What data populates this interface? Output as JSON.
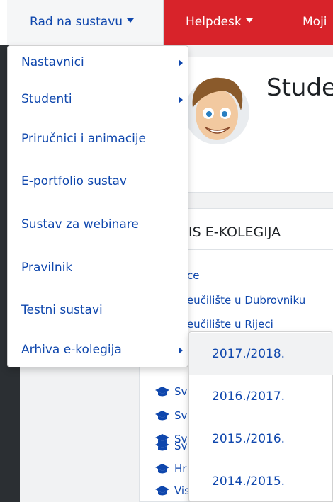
{
  "navbar": {
    "items": [
      {
        "label": "Rad na sustavu",
        "active": true
      },
      {
        "label": "Helpdesk",
        "active": false
      },
      {
        "label": "Moji",
        "active": false
      }
    ]
  },
  "profile": {
    "title": "Stude"
  },
  "courses": {
    "header": "IS E-KOLEGIJA",
    "lines": [
      "ce",
      "veučilište u Dubrovniku",
      "veučilište u Rijeci"
    ],
    "cap_items": [
      "Sv",
      "Sv",
      "Sv",
      "Sv",
      "Hr",
      "Vis"
    ]
  },
  "dropdown": {
    "items": [
      {
        "label": "Nastavnici",
        "has_submenu": true
      },
      {
        "label": "Studenti",
        "has_submenu": true
      },
      {
        "label": "Priručnici i animacije",
        "has_submenu": false
      },
      {
        "label": "E-portfolio sustav",
        "has_submenu": false
      },
      {
        "label": "Sustav za webinare",
        "has_submenu": false
      },
      {
        "label": "Pravilnik",
        "has_submenu": false
      },
      {
        "label": "Testni sustavi",
        "has_submenu": false
      },
      {
        "label": "Arhiva e-kolegija",
        "has_submenu": true
      }
    ]
  },
  "submenu": {
    "items": [
      "2017./2018.",
      "2016./2017.",
      "2015./2016.",
      "2014./2015."
    ]
  },
  "colors": {
    "brand_red": "#d8232a",
    "link_blue": "#0f47ad",
    "sidebar_dark": "#2b2f33"
  },
  "icons": [
    "caret-down-icon",
    "chevron-right-icon",
    "graduation-cap-icon",
    "avatar-image"
  ]
}
